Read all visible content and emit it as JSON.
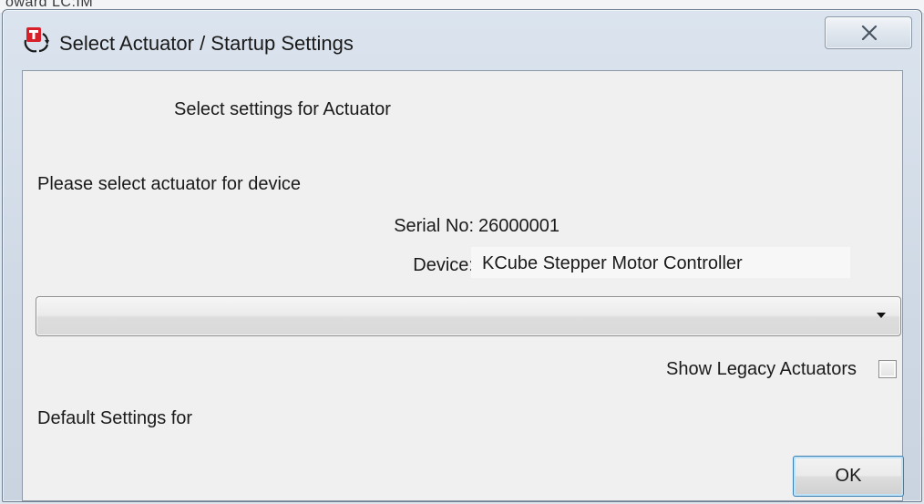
{
  "background_window": {
    "title_fragment": "oward   LC:IM"
  },
  "window": {
    "title": "Select Actuator / Startup Settings",
    "close_icon": "close-icon",
    "app_icon": "thorlabs-icon"
  },
  "dialog": {
    "heading": "Select settings for Actuator",
    "prompt": "Please select actuator for device",
    "serial_label": "Serial No:",
    "serial_value": "26000001",
    "device_label": "Device:",
    "device_value": "KCube Stepper Motor Controller",
    "actuator_select": {
      "selected_value": ""
    },
    "legacy_checkbox": {
      "label": "Show Legacy Actuators",
      "checked": false
    },
    "defaults_label": "Default Settings for",
    "ok_label": "OK"
  },
  "colors": {
    "frame": "#d6dfea",
    "client_background": "#f0f0f0",
    "ok_focus": "#3c7fb1"
  }
}
